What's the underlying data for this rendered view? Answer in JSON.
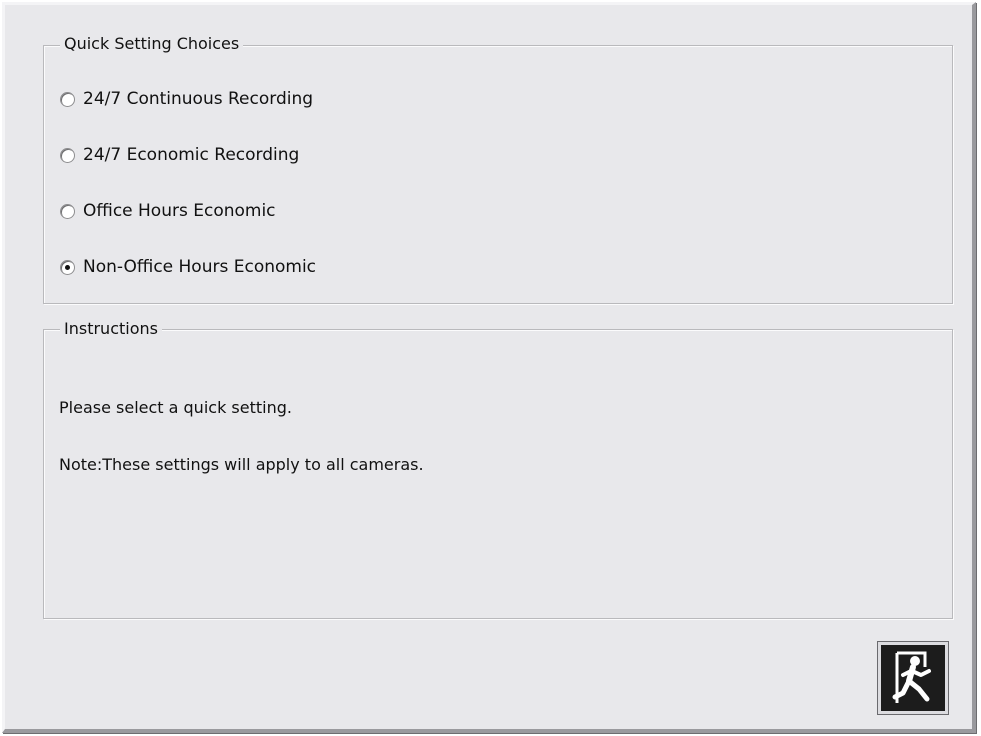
{
  "quick_settings": {
    "legend": "Quick Setting Choices",
    "options": [
      {
        "label": "24/7 Continuous Recording",
        "selected": false
      },
      {
        "label": "24/7 Economic Recording",
        "selected": false
      },
      {
        "label": "Office Hours Economic",
        "selected": false
      },
      {
        "label": "Non-Office Hours Economic",
        "selected": true
      }
    ]
  },
  "instructions": {
    "legend": "Instructions",
    "lines": [
      "Please select a quick setting.",
      "Note:These settings will apply to all cameras."
    ]
  },
  "exit_button": {
    "icon": "exit-door-icon"
  }
}
